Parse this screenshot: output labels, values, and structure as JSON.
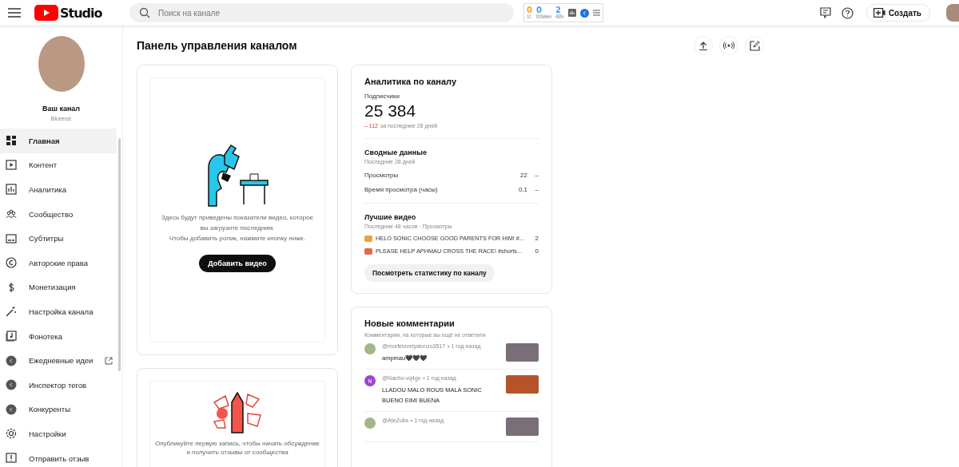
{
  "header": {
    "logo": "Studio",
    "search_placeholder": "Поиск на канале",
    "counters": [
      {
        "value": "0",
        "label": "1г",
        "color": "#f5a623"
      },
      {
        "value": "0",
        "label": "60мин",
        "color": "#4a9fe8"
      },
      {
        "value": "2",
        "label": "48ч",
        "color": "#4a9fe8"
      }
    ],
    "create_button": "Создать"
  },
  "channel": {
    "title": "Ваш канал",
    "name": "Blueece"
  },
  "nav": [
    {
      "label": "Главная",
      "kind": "page",
      "selected": true,
      "external": false
    },
    {
      "label": "Контент",
      "kind": "page",
      "selected": false,
      "external": false
    },
    {
      "label": "Аналитика",
      "kind": "page",
      "selected": false,
      "external": false
    },
    {
      "label": "Сообщество",
      "kind": "page",
      "selected": false,
      "external": false
    },
    {
      "label": "Субтитры",
      "kind": "page",
      "selected": false,
      "external": false
    },
    {
      "label": "Авторские права",
      "kind": "page",
      "selected": false,
      "external": false
    },
    {
      "label": "Монетизация",
      "kind": "page",
      "selected": false,
      "external": false
    },
    {
      "label": "Настройка канала",
      "kind": "page",
      "selected": false,
      "external": false
    },
    {
      "label": "Фонотека",
      "kind": "page",
      "selected": false,
      "external": false
    },
    {
      "label": "Ежедневные идеи",
      "kind": "extension",
      "selected": false,
      "external": true
    },
    {
      "label": "Инспектор тегов",
      "kind": "extension",
      "selected": false,
      "external": false
    },
    {
      "label": "Конкуренты",
      "kind": "extension",
      "selected": false,
      "external": false
    },
    {
      "label": "Настройки",
      "kind": "page",
      "selected": false,
      "external": false
    },
    {
      "label": "Отправить отзыв",
      "kind": "page",
      "selected": false,
      "external": false
    }
  ],
  "page_title": "Панель управления каналом",
  "upload_card": {
    "text": "Здесь будут приведены показатели видео, которое вы загрузите последним.",
    "hint": "Чтобы добавить ролик, нажмите кнопку ниже.",
    "button": "Добавить видео"
  },
  "community_card": {
    "text": "Опубликуйте первую запись, чтобы начать обсуждение и получить отзывы от сообщества"
  },
  "analytics": {
    "title": "Аналитика по каналу",
    "subscribers_label": "Подписчики",
    "subscribers": "25 384",
    "delta": "– 112",
    "delta_text": "за последние 28 дней",
    "summary": {
      "title": "Сводные данные",
      "period": "Последние 28 дней",
      "rows": [
        {
          "label": "Просмотры",
          "value": "22",
          "trend": "–"
        },
        {
          "label": "Время просмотра (часы)",
          "value": "0,1",
          "trend": "–"
        }
      ]
    },
    "top": {
      "title": "Лучшие видео",
      "period": "Последние 48 часов · Просмотры",
      "videos": [
        {
          "title": "HELO SONIC CHOOSE GOOD PARENTS FOR HIM! #...",
          "views": "2"
        },
        {
          "title": "PLEASE HELP APHMAU CROSS THE RACE! #shorts...",
          "views": "0"
        }
      ]
    },
    "button": "Посмотреть статистику по каналу"
  },
  "comments": {
    "title": "Новые комментарии",
    "subtitle": "Комментарии, на которые вы ещё не ответили",
    "items": [
      {
        "author": "@morfelovelyalonzo3517",
        "time": "• 1 год назад",
        "text": "ampmau🖤🖤🖤",
        "kind": "photo"
      },
      {
        "author": "@Nacho-vq4gv",
        "time": "• 1 год назад",
        "text": "LLADOU MALO ROUS MALA SONIC BUENO EIMI BUENA",
        "kind": "letter",
        "letter": "N",
        "color": "#a142d0"
      },
      {
        "author": "@AteZulia",
        "time": "• 1 год назад",
        "kind": "photo"
      }
    ]
  }
}
